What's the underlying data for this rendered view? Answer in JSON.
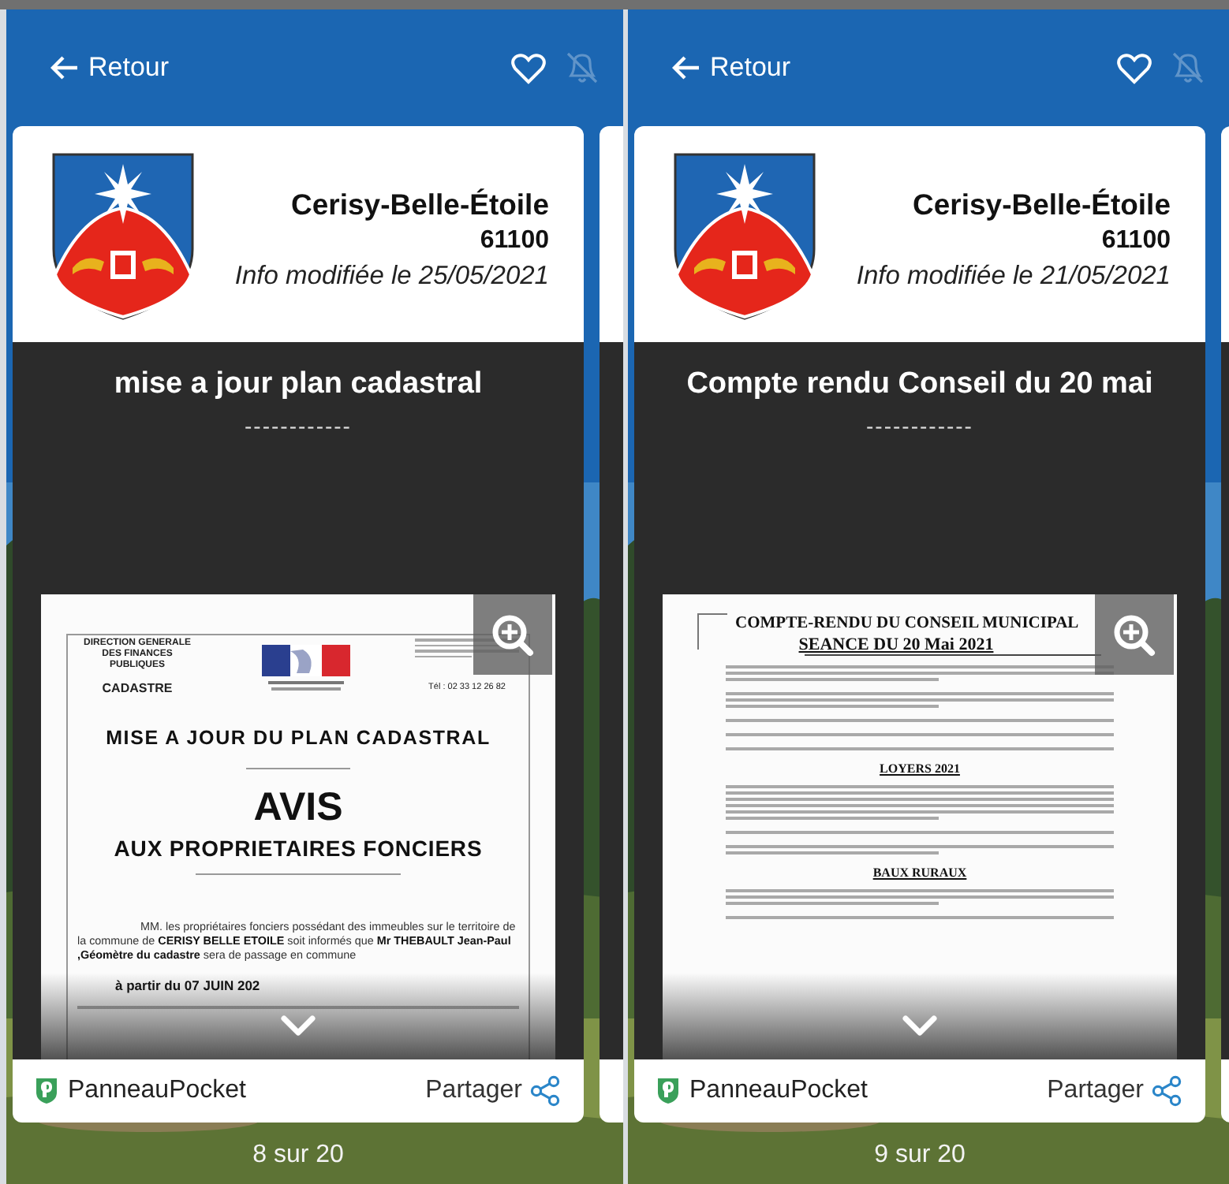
{
  "screens": [
    {
      "back_label": "Retour",
      "favorite": false,
      "notifications": false,
      "card": {
        "town": "Cerisy-Belle-Étoile",
        "postcode": "61100",
        "modified": "Info modifiée le 25/05/2021",
        "title": "mise a jour plan cadastral",
        "separator": "------------",
        "document": {
          "kind": "notice",
          "authority": [
            "DIRECTION GENERALE",
            "DES FINANCES",
            "PUBLIQUES"
          ],
          "department": "CADASTRE",
          "phone": "Tél : 02 33 12 26 82",
          "heading": "MISE A JOUR DU PLAN CADASTRAL",
          "title": "AVIS",
          "subtitle": "AUX PROPRIETAIRES FONCIERS",
          "body": "MM. les propriétaires fonciers possédant des immeubles sur le territoire de la commune de **CERISY BELLE ETOILE** soit informés que **Mr THEBAULT Jean-Paul ,Géomètre du cadastre** sera de passage en commune",
          "date_line": "à partir du 07 JUIN 202"
        },
        "source": "PanneauPocket",
        "share": "Partager"
      },
      "pager": "8 sur 20"
    },
    {
      "back_label": "Retour",
      "favorite": false,
      "notifications": false,
      "card": {
        "town": "Cerisy-Belle-Étoile",
        "postcode": "61100",
        "modified": "Info modifiée le 21/05/2021",
        "title": "Compte rendu Conseil du 20 mai",
        "separator": "------------",
        "document": {
          "kind": "minutes",
          "title": "COMPTE-RENDU DU CONSEIL MUNICIPAL",
          "subtitle": "SEANCE DU 20 Mai 2021",
          "sections": [
            {
              "heading": "LOYERS 2021"
            },
            {
              "heading": "BAUX RURAUX"
            }
          ]
        },
        "source": "PanneauPocket",
        "share": "Partager"
      },
      "pager": "9 sur 20"
    }
  ]
}
